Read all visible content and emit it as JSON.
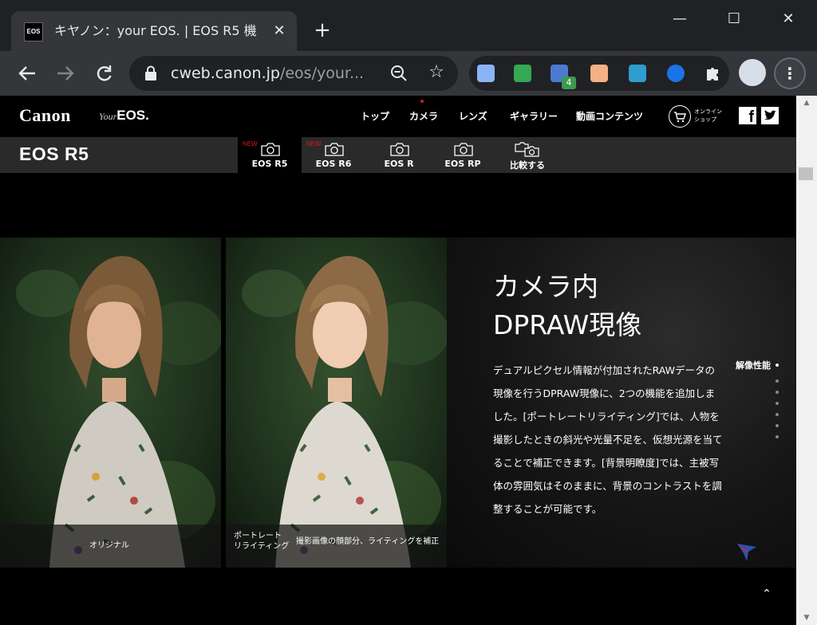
{
  "browser": {
    "tab": {
      "title": "キヤノン：your EOS. | EOS R5 機",
      "favicon_text": "EOS"
    },
    "new_tab_symbol": "+",
    "window_controls": {
      "minimize": "—",
      "maximize": "☐",
      "close": "✕"
    },
    "address": {
      "domain": "cweb.canon.jp",
      "path": "/eos/your..."
    },
    "extension_badge": "4"
  },
  "site": {
    "logo": "Canon",
    "sublogo_your": "Your",
    "sublogo_eos": "EOS.",
    "nav": [
      "トップ",
      "カメラ",
      "レンズ",
      "ギャラリー",
      "動画コンテンツ"
    ],
    "shop_label_line1": "オンライン",
    "shop_label_line2": "ショップ",
    "facebook_glyph": "f"
  },
  "subnav": {
    "model_title": "EOS R5",
    "tabs": [
      {
        "label": "EOS R5",
        "new": "NEW"
      },
      {
        "label": "EOS R6",
        "new": "NEW"
      },
      {
        "label": "EOS R",
        "new": ""
      },
      {
        "label": "EOS RP",
        "new": ""
      },
      {
        "label": "比較する",
        "new": ""
      }
    ]
  },
  "photos": {
    "left_caption": "オリジナル",
    "right_caption_title_1": "ポートレート",
    "right_caption_title_2": "リライティング",
    "right_caption_desc": "撮影画像の顔部分、ライティングを補正"
  },
  "feature": {
    "title_line1": "カメラ内",
    "title_line2": "DPRAW現像",
    "body": "デュアルピクセル情報が付加されたRAWデータの現像を行うDPRAW現像に、2つの機能を追加しました。[ポートレートリライティング]では、人物を撮影したときの斜光や光量不足を、仮想光源を当てることで補正できます。[背景明瞭度]では、主被写体の雰囲気はそのままに、背景のコントラストを調整することが可能です。",
    "side_label": "解像性能"
  },
  "back_to_top": "⌃",
  "colors": {
    "accent_red": "#e3141c",
    "chrome_dark": "#202124",
    "chrome_mid": "#35363a"
  }
}
